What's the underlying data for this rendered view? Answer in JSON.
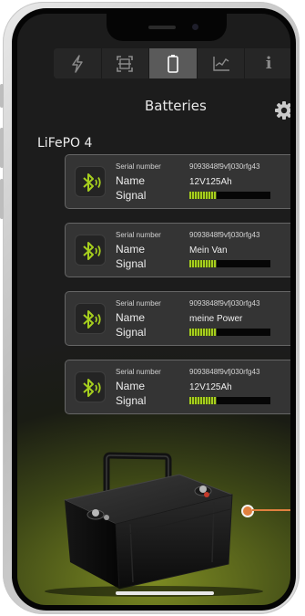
{
  "header": {
    "title": "Batteries",
    "settings_icon": "gear-icon"
  },
  "tabs": [
    {
      "icon": "lightning-icon",
      "active": false
    },
    {
      "icon": "scan-frame-icon",
      "active": false
    },
    {
      "icon": "battery-icon",
      "active": true
    },
    {
      "icon": "chart-icon",
      "active": false
    },
    {
      "icon": "info-icon",
      "glyph": "i",
      "active": false
    }
  ],
  "section": {
    "label": "LiFePO 4"
  },
  "labels": {
    "serial": "Serial number",
    "name": "Name",
    "signal": "Signal"
  },
  "batteries": [
    {
      "serial": "9093848f9vfj030rfg43",
      "name": "12V125Ah",
      "signal_fraction": 0.34
    },
    {
      "serial": "9093848f9vfj030rfg43",
      "name": "Mein Van",
      "signal_fraction": 0.34
    },
    {
      "serial": "9093848f9vfj030rfg43",
      "name": "meine Power",
      "signal_fraction": 0.34
    },
    {
      "serial": "9093848f9vfj030rfg43",
      "name": "12V125Ah",
      "signal_fraction": 0.34
    }
  ],
  "colors": {
    "accent_green": "#a6cf1e",
    "callout_orange": "#e0803f",
    "screen_bg": "#1c1c1c",
    "card_bg": "#343434"
  }
}
